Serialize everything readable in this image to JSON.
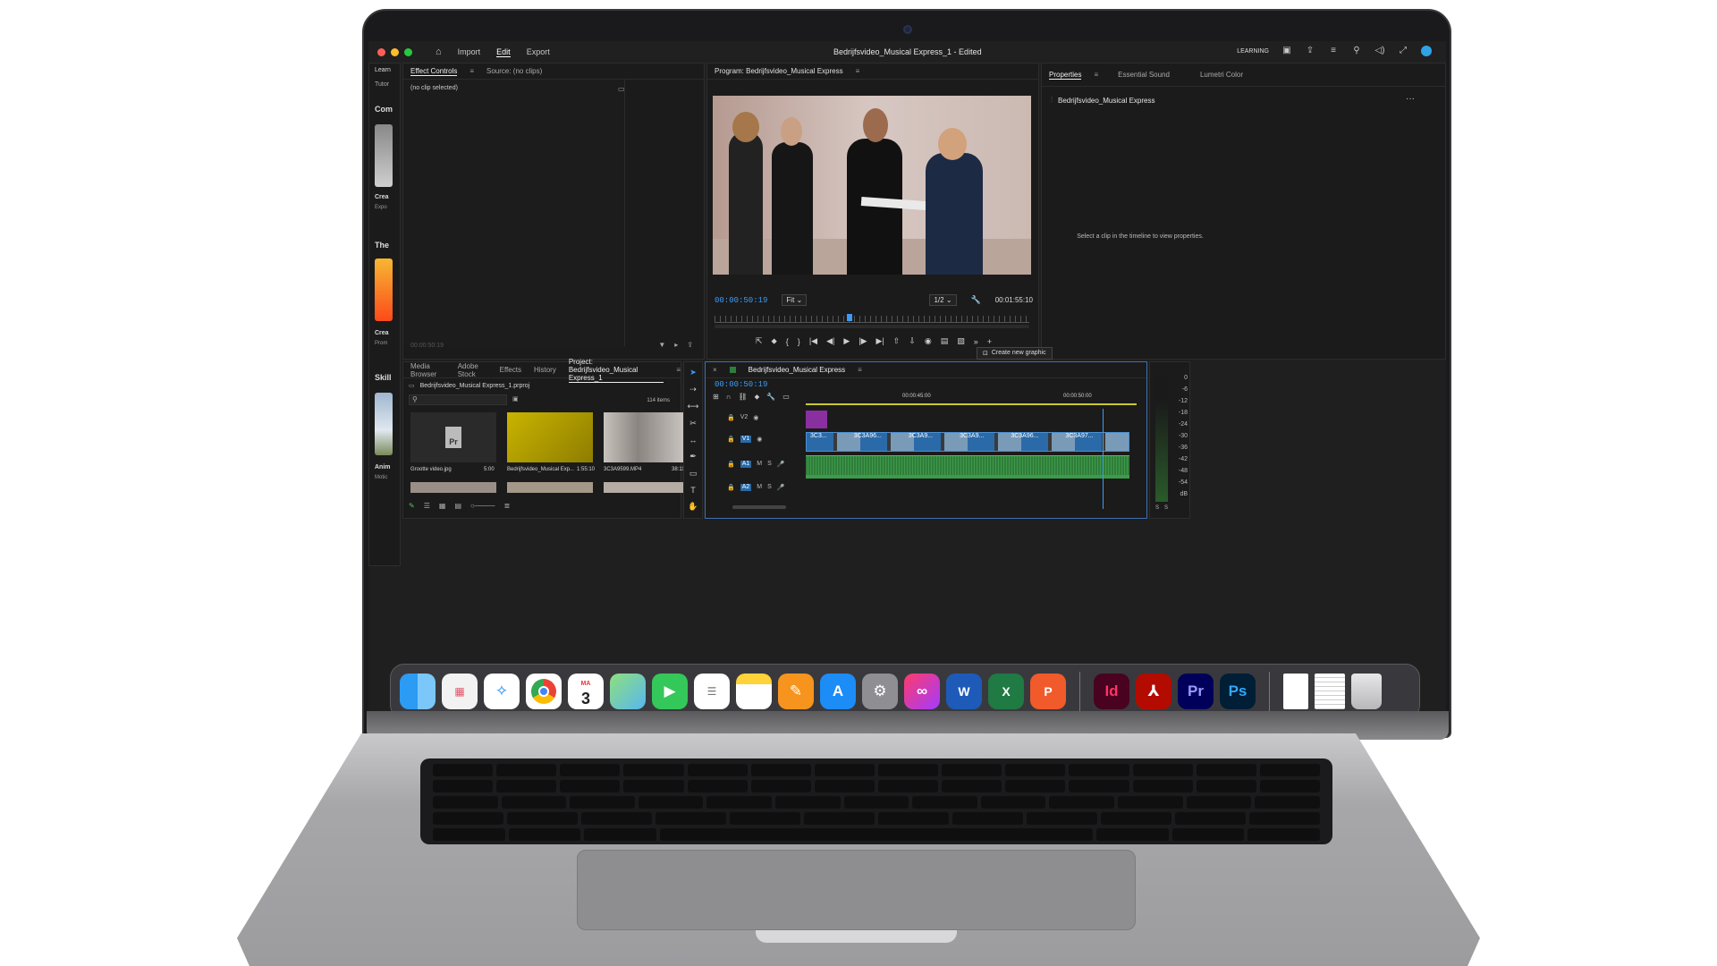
{
  "app": {
    "menu": [
      "Import",
      "Edit",
      "Export"
    ],
    "active_menu": "Edit",
    "document_title": "Bedrijfsvideo_Musical Express_1 - Edited",
    "workspace_label": "LEARNING"
  },
  "learn_panel": {
    "tabs": [
      "Learn",
      "Tutor"
    ],
    "headings": [
      "Com",
      "The",
      "Skill"
    ],
    "items": [
      {
        "title": "Crea",
        "sub": "Expo"
      },
      {
        "title": "Crea",
        "sub": "Prom"
      },
      {
        "title": "Anim",
        "sub": "Motic"
      }
    ]
  },
  "effect_controls": {
    "tabs": [
      "Effect Controls",
      "Source: (no clips)"
    ],
    "no_clip": "(no clip selected)",
    "timecode": "00:00:50:19"
  },
  "program_monitor": {
    "title": "Program: Bedrijfsvideo_Musical Express",
    "timecode": "00:00:50:19",
    "fit": "Fit",
    "resolution": "1/2",
    "duration": "00:01:55:10"
  },
  "properties": {
    "tabs": [
      "Properties",
      "Essential Sound",
      "Lumetri Color"
    ],
    "sequence_name": "Bedrijfsvideo_Musical Express",
    "empty_message": "Select a clip in the timeline to view properties.",
    "create_button": "Create new graphic"
  },
  "project": {
    "tabs": [
      "Media Browser",
      "Adobe Stock",
      "Effects",
      "History",
      "Project: Bedrijfsvideo_Musical Express_1"
    ],
    "file": "Bedrijfsvideo_Musical Express_1.prproj",
    "item_count": "114 items",
    "items": [
      {
        "name": "Grootte video.jpg",
        "duration": "5:00"
      },
      {
        "name": "Bedrijfsvideo_Musical Exp...",
        "duration": "1:55:10"
      },
      {
        "name": "3C3A9599.MP4",
        "duration": "38:11"
      }
    ]
  },
  "timeline": {
    "sequence": "Bedrijfsvideo_Musical Express",
    "timecode": "00:00:50:19",
    "ruler": [
      "00:00:45:00",
      "00:00:50:00"
    ],
    "tracks": [
      "V2",
      "V1",
      "A1",
      "A2"
    ],
    "track_buttons": [
      "M",
      "S"
    ],
    "clips": [
      "3C3...",
      "3C3A96...",
      "3C3A9...",
      "3C3A9...",
      "3C3A96...",
      "3C3A97..."
    ],
    "clip_fx": "fx"
  },
  "audio_meter": {
    "labels": [
      "0",
      "-6",
      "-12",
      "-18",
      "-24",
      "-30",
      "-36",
      "-42",
      "-48",
      "-54",
      "dB"
    ],
    "channels": [
      "S",
      "S"
    ]
  },
  "dock": {
    "calendar_month": "MA",
    "calendar_day": "3",
    "apps": [
      "Finder",
      "Launchpad",
      "Safari",
      "Chrome",
      "Calendar",
      "Maps",
      "FaceTime",
      "Reminders",
      "Notes",
      "Pages",
      "App Store",
      "System Settings",
      "Creative Cloud",
      "Word",
      "Excel",
      "PowerPoint",
      "InDesign",
      "Acrobat",
      "Premiere Pro",
      "Photoshop",
      "Document",
      "Preview",
      "Trash"
    ],
    "labels": {
      "indesign": "Id",
      "premiere": "Pr",
      "photoshop": "Ps",
      "project_file": "Pr"
    }
  },
  "colors": {
    "accent_blue": "#3d9bf5",
    "indesign": "#49021f",
    "premiere": "#00005b",
    "photoshop": "#001e36",
    "clip_blue": "#2a6aa8",
    "audio_green": "#2f7d3a"
  }
}
